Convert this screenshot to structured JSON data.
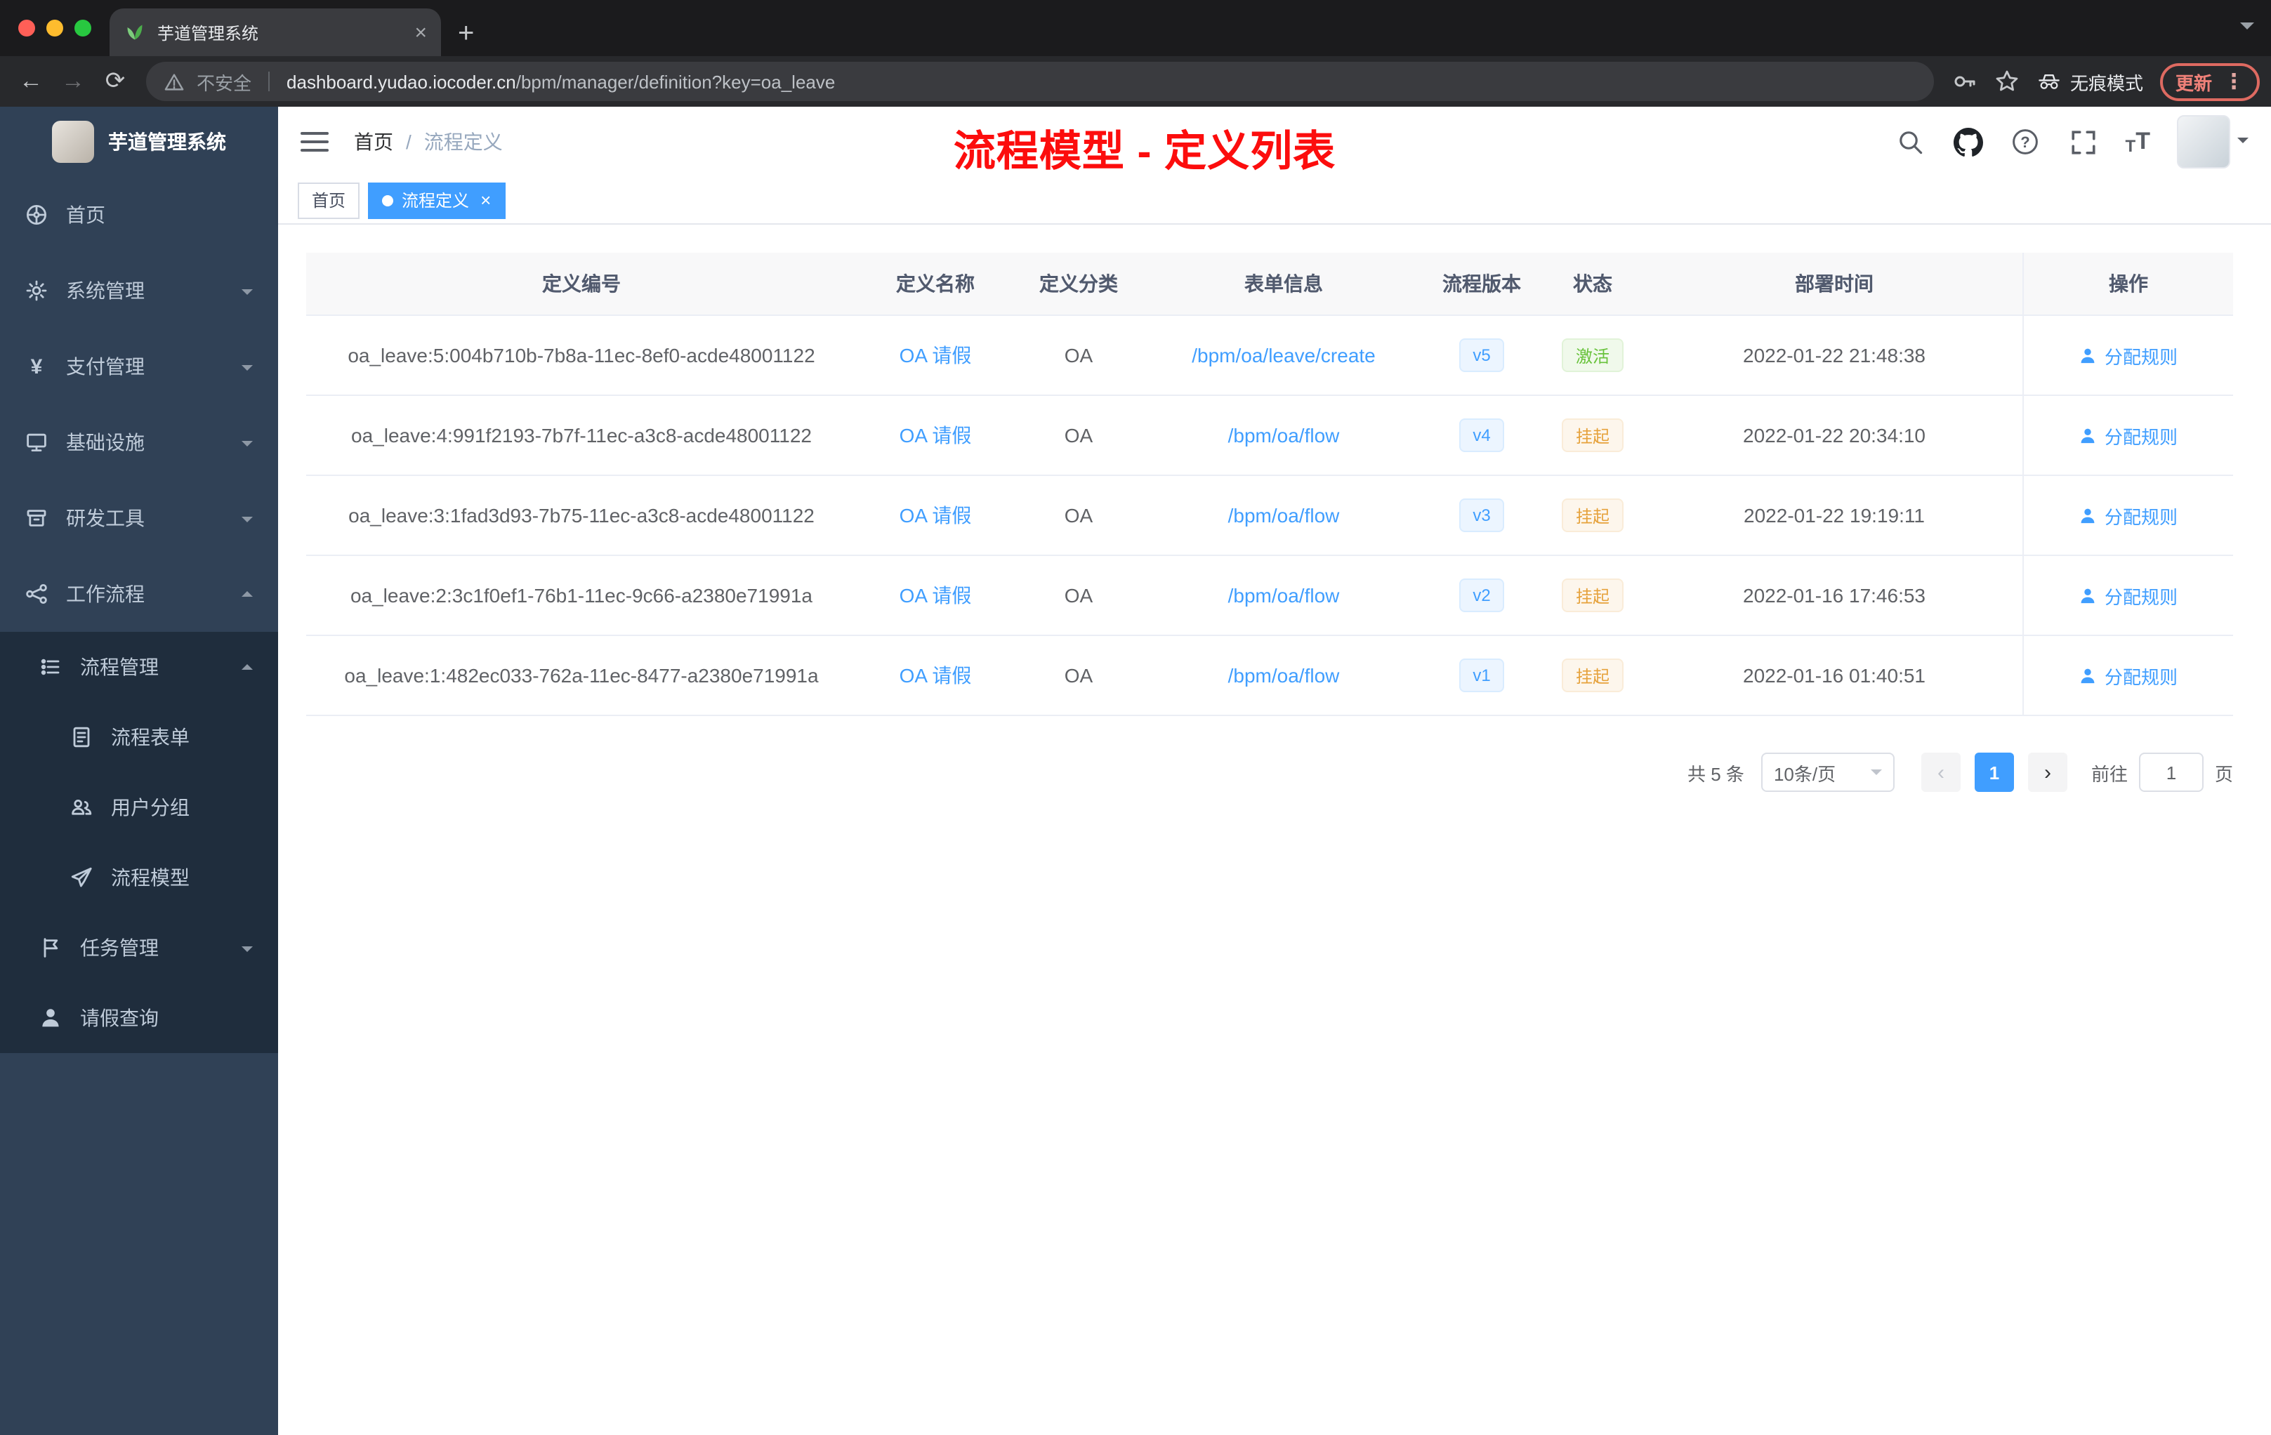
{
  "browser": {
    "tab_title": "芋道管理系统",
    "security_label": "不安全",
    "url_domain": "dashboard.yudao.iocoder.cn",
    "url_path": "/bpm/manager/definition?key=oa_leave",
    "incognito_label": "无痕模式",
    "update_label": "更新"
  },
  "sidebar": {
    "logo_title": "芋道管理系统",
    "items": [
      {
        "label": "首页"
      },
      {
        "label": "系统管理"
      },
      {
        "label": "支付管理"
      },
      {
        "label": "基础设施"
      },
      {
        "label": "研发工具"
      },
      {
        "label": "工作流程"
      },
      {
        "label": "流程管理"
      },
      {
        "label": "流程表单"
      },
      {
        "label": "用户分组"
      },
      {
        "label": "流程模型"
      },
      {
        "label": "任务管理"
      },
      {
        "label": "请假查询"
      }
    ]
  },
  "navbar": {
    "breadcrumb": {
      "home": "首页",
      "separator": "/",
      "current": "流程定义"
    },
    "annotation": "流程模型 - 定义列表"
  },
  "tags": {
    "home": "首页",
    "current": "流程定义"
  },
  "table": {
    "headers": [
      "定义编号",
      "定义名称",
      "定义分类",
      "表单信息",
      "流程版本",
      "状态",
      "部署时间",
      "操作"
    ],
    "rows": [
      {
        "id": "oa_leave:5:004b710b-7b8a-11ec-8ef0-acde48001122",
        "name": "OA 请假",
        "category": "OA",
        "form": "/bpm/oa/leave/create",
        "version": "v5",
        "status": "激活",
        "time": "2022-01-22 21:48:38",
        "action": "分配规则"
      },
      {
        "id": "oa_leave:4:991f2193-7b7f-11ec-a3c8-acde48001122",
        "name": "OA 请假",
        "category": "OA",
        "form": "/bpm/oa/flow",
        "version": "v4",
        "status": "挂起",
        "time": "2022-01-22 20:34:10",
        "action": "分配规则"
      },
      {
        "id": "oa_leave:3:1fad3d93-7b75-11ec-a3c8-acde48001122",
        "name": "OA 请假",
        "category": "OA",
        "form": "/bpm/oa/flow",
        "version": "v3",
        "status": "挂起",
        "time": "2022-01-22 19:19:11",
        "action": "分配规则"
      },
      {
        "id": "oa_leave:2:3c1f0ef1-76b1-11ec-9c66-a2380e71991a",
        "name": "OA 请假",
        "category": "OA",
        "form": "/bpm/oa/flow",
        "version": "v2",
        "status": "挂起",
        "time": "2022-01-16 17:46:53",
        "action": "分配规则"
      },
      {
        "id": "oa_leave:1:482ec033-762a-11ec-8477-a2380e71991a",
        "name": "OA 请假",
        "category": "OA",
        "form": "/bpm/oa/flow",
        "version": "v1",
        "status": "挂起",
        "time": "2022-01-16 01:40:51",
        "action": "分配规则"
      }
    ]
  },
  "pagination": {
    "total": "共 5 条",
    "page_size": "10条/页",
    "current_page": "1",
    "goto_label": "前往",
    "goto_value": "1",
    "unit_label": "页"
  },
  "colors": {
    "accent": "#409eff",
    "success": "#67c23a",
    "warning": "#e6a23c",
    "annotation_red": "#ff0000",
    "sidebar_bg": "#304156",
    "submenu_bg": "#1f2d3d"
  }
}
